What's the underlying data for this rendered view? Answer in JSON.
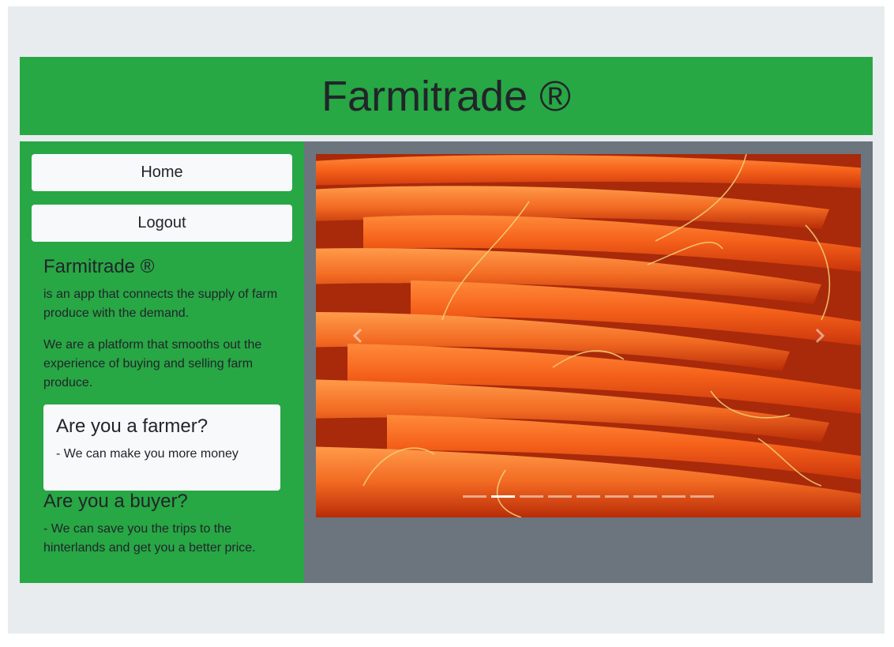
{
  "header": {
    "title": "Farmitrade ®"
  },
  "sidebar": {
    "home_label": "Home",
    "logout_label": "Logout",
    "about": {
      "title": "Farmitrade ®",
      "p1": "is an app that connects the supply of farm produce with the demand.",
      "p2": "We are a platform that smooths out the experience of buying and selling farm produce."
    },
    "farmer": {
      "title": "Are you a farmer?",
      "text": "- We can make you more money"
    },
    "buyer": {
      "title": "Are you a buyer?",
      "text": "- We can save you the trips to the hinterlands and get you a better price."
    }
  },
  "carousel": {
    "prev_icon": "chevron-left-icon",
    "next_icon": "chevron-right-icon",
    "slide_count": 9,
    "active_index": 1
  },
  "colors": {
    "page_bg": "#e9ecef",
    "brand_green": "#28a745",
    "panel_gray": "#6c757d",
    "button_light": "#f8f9fa",
    "text_dark": "#212529"
  }
}
